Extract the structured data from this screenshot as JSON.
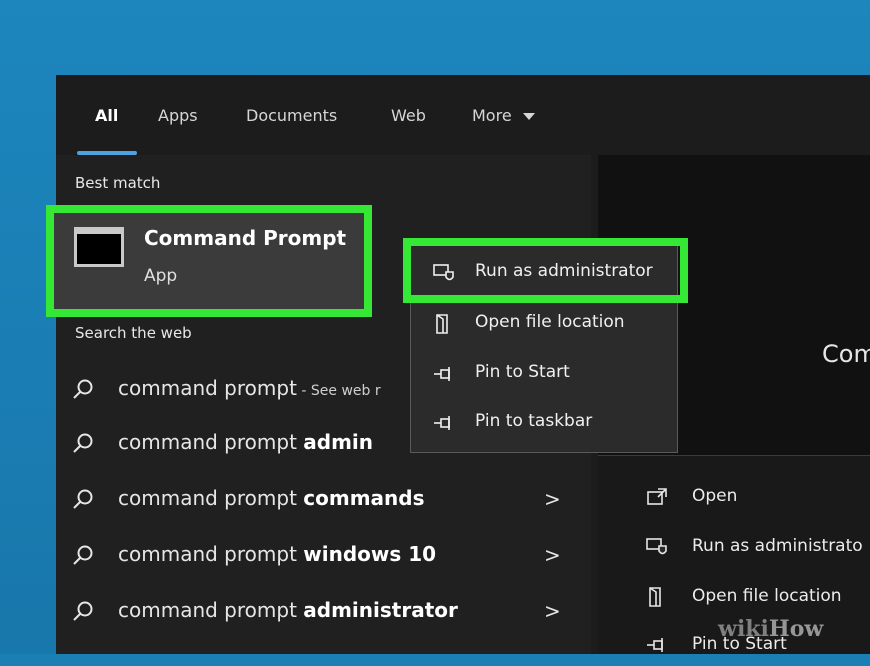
{
  "tabs": [
    {
      "label": "All",
      "active": true
    },
    {
      "label": "Apps"
    },
    {
      "label": "Documents"
    },
    {
      "label": "Web"
    },
    {
      "label": "More"
    }
  ],
  "more_icon": "caret-down-icon",
  "best_match": {
    "section_label": "Best match",
    "title": "Command Prompt",
    "subtitle": "App",
    "icon": "terminal-icon"
  },
  "search_web": {
    "section_label": "Search the web",
    "rows": [
      {
        "prefix": "command prompt",
        "bold": "",
        "suffix": " - See web r",
        "chevron": ""
      },
      {
        "prefix": "command prompt ",
        "bold": "admin",
        "suffix": "",
        "chevron": ""
      },
      {
        "prefix": "command prompt ",
        "bold": "commands",
        "suffix": "",
        "chevron": ">"
      },
      {
        "prefix": "command prompt ",
        "bold": "windows 10",
        "suffix": "",
        "chevron": ">"
      },
      {
        "prefix": "command prompt ",
        "bold": "administrator",
        "suffix": "",
        "chevron": ">"
      }
    ]
  },
  "context_menu": {
    "items": [
      {
        "label": "Run as administrator",
        "icon": "shield-run-icon"
      },
      {
        "label": "Open file location",
        "icon": "file-location-icon"
      },
      {
        "label": "Pin to Start",
        "icon": "pin-icon"
      },
      {
        "label": "Pin to taskbar",
        "icon": "pin-icon"
      }
    ]
  },
  "preview": {
    "title": "Com",
    "actions": [
      {
        "label": "Open",
        "icon": "open-icon"
      },
      {
        "label": "Run as administrato",
        "icon": "shield-run-icon"
      },
      {
        "label": "Open file location",
        "icon": "file-location-icon"
      },
      {
        "label": "Pin to Start",
        "icon": "pin-icon"
      }
    ]
  },
  "watermark": {
    "part1": "wiki",
    "part2": "How"
  },
  "colors": {
    "highlight_green": "#35e835",
    "accent_blue": "#4ca3e0",
    "panel_bg": "#1c1c1c"
  }
}
